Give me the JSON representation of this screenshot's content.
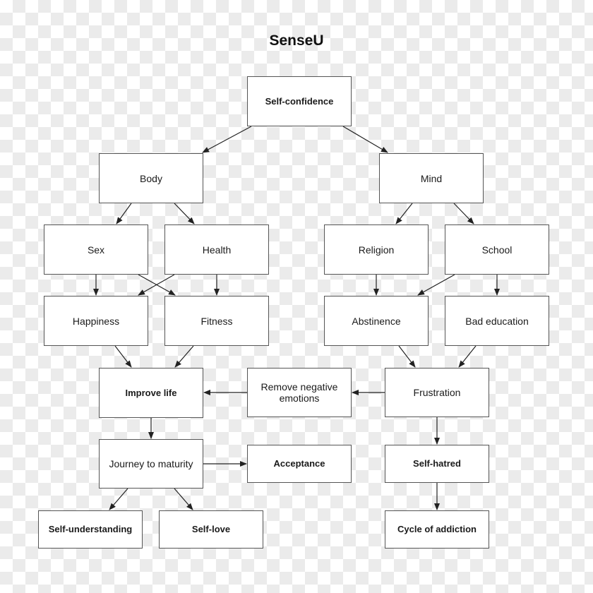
{
  "diagram": {
    "title": "SenseU",
    "colors": {
      "box_border": "#555555",
      "edge": "#222222",
      "background_checker": "#ebebeb"
    },
    "nodes": [
      {
        "id": "self-confidence",
        "label": "Self-confidence",
        "bold": true
      },
      {
        "id": "body",
        "label": "Body",
        "bold": false
      },
      {
        "id": "mind",
        "label": "Mind",
        "bold": false
      },
      {
        "id": "sex",
        "label": "Sex",
        "bold": false
      },
      {
        "id": "health",
        "label": "Health",
        "bold": false
      },
      {
        "id": "religion",
        "label": "Religion",
        "bold": false
      },
      {
        "id": "school",
        "label": "School",
        "bold": false
      },
      {
        "id": "happiness",
        "label": "Happiness",
        "bold": false
      },
      {
        "id": "fitness",
        "label": "Fitness",
        "bold": false
      },
      {
        "id": "abstinence",
        "label": "Abstinence",
        "bold": false
      },
      {
        "id": "bad-education",
        "label": "Bad education",
        "bold": false
      },
      {
        "id": "improve-life",
        "label": "Improve life",
        "bold": true
      },
      {
        "id": "remove-negative-emotions",
        "label": "Remove negative\nemotions",
        "bold": false
      },
      {
        "id": "frustration",
        "label": "Frustration",
        "bold": false
      },
      {
        "id": "journey-to-maturity",
        "label": "Journey to maturity",
        "bold": false
      },
      {
        "id": "acceptance",
        "label": "Acceptance",
        "bold": true
      },
      {
        "id": "self-hatred",
        "label": "Self-hatred",
        "bold": true
      },
      {
        "id": "self-understanding",
        "label": "Self-understanding",
        "bold": true
      },
      {
        "id": "self-love",
        "label": "Self-love",
        "bold": true
      },
      {
        "id": "cycle-of-addiction",
        "label": "Cycle of addiction",
        "bold": true
      }
    ],
    "edges": [
      {
        "from": "self-confidence",
        "to": "body"
      },
      {
        "from": "self-confidence",
        "to": "mind"
      },
      {
        "from": "body",
        "to": "sex"
      },
      {
        "from": "body",
        "to": "health"
      },
      {
        "from": "mind",
        "to": "religion"
      },
      {
        "from": "mind",
        "to": "school"
      },
      {
        "from": "sex",
        "to": "happiness"
      },
      {
        "from": "sex",
        "to": "fitness"
      },
      {
        "from": "health",
        "to": "happiness"
      },
      {
        "from": "health",
        "to": "fitness"
      },
      {
        "from": "religion",
        "to": "abstinence"
      },
      {
        "from": "school",
        "to": "abstinence"
      },
      {
        "from": "school",
        "to": "bad-education"
      },
      {
        "from": "happiness",
        "to": "improve-life"
      },
      {
        "from": "fitness",
        "to": "improve-life"
      },
      {
        "from": "abstinence",
        "to": "frustration"
      },
      {
        "from": "bad-education",
        "to": "frustration"
      },
      {
        "from": "frustration",
        "to": "remove-negative-emotions"
      },
      {
        "from": "remove-negative-emotions",
        "to": "improve-life"
      },
      {
        "from": "improve-life",
        "to": "journey-to-maturity"
      },
      {
        "from": "journey-to-maturity",
        "to": "acceptance"
      },
      {
        "from": "journey-to-maturity",
        "to": "self-understanding"
      },
      {
        "from": "journey-to-maturity",
        "to": "self-love"
      },
      {
        "from": "frustration",
        "to": "self-hatred"
      },
      {
        "from": "self-hatred",
        "to": "cycle-of-addiction"
      }
    ]
  }
}
